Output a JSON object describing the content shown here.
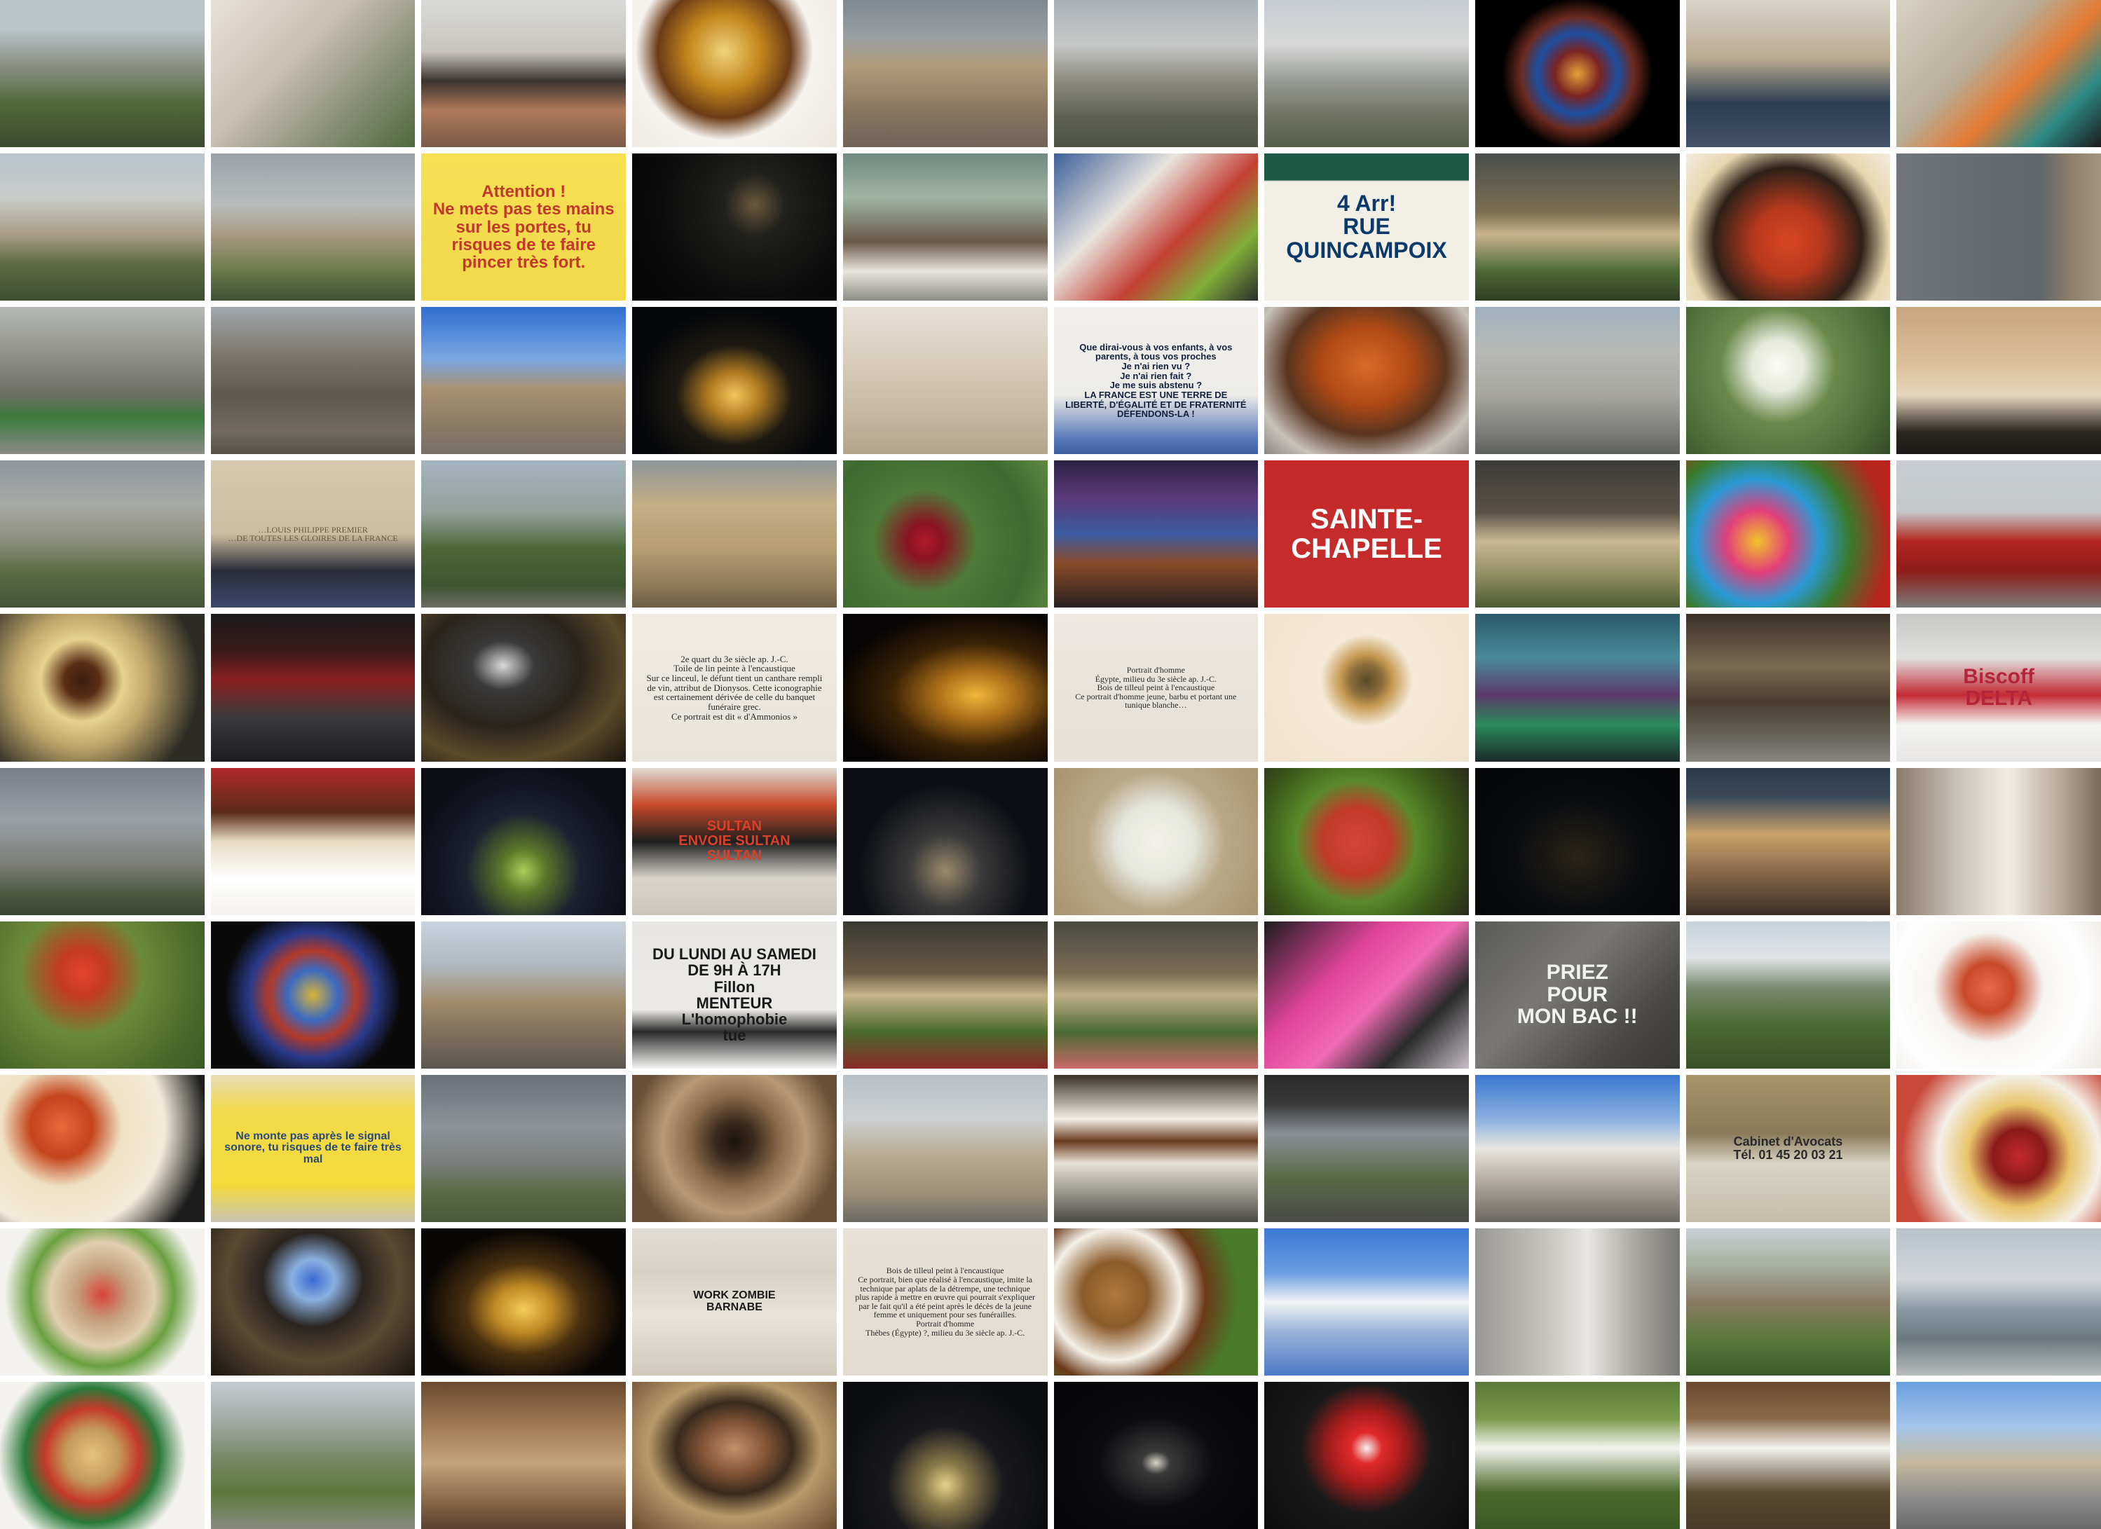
{
  "gallery": {
    "tiles": [
      {
        "bg": "linear-gradient(180deg,#b9c4c9 0%,#b9c4c9 20%,#8a8f82 45%,#4f6a3a 70%,#3a4a2e 100%)"
      },
      {
        "bg": "linear-gradient(135deg,#e8e1d6 0%,#c9bfb0 40%,#8a9078 70%,#4c6a3c 100%)"
      },
      {
        "bg": "linear-gradient(180deg,#d9dad8 0%,#c8c4bd 35%,#3a3430 55%,#b07a5a 75%,#7a5a48 100%)"
      },
      {
        "bg": "radial-gradient(circle at 45% 35%,#f1d27a 0%,#c2861c 25%,#6b3b16 45%,#f6f3ef 60%,#ebe5dd 100%)"
      },
      {
        "bg": "linear-gradient(180deg,#7f8890 0%,#9aa0a3 25%,#b29b7c 45%,#8a7660 75%,#6e6458 100%)"
      },
      {
        "bg": "linear-gradient(180deg,#a9b0b7 0%,#c7c9c8 30%,#8b8a7f 55%,#5e6152 80%,#4e5445 100%)"
      },
      {
        "bg": "linear-gradient(180deg,#c6ccd2 0%,#d8d9d8 30%,#979a94 55%,#6e715e 80%,#55604a 100%)"
      },
      {
        "bg": "radial-gradient(circle at 50% 50%,#e7a13a 0%,#7a2323 18%,#1d4ea0 32%,#6b2a1f 45%,#000000 60%)"
      },
      {
        "bg": "linear-gradient(180deg,#d9d4ca 0%,#b8aa90 40%,#2c3e52 70%,#42536a 100%)"
      },
      {
        "bg": "linear-gradient(135deg,#d8d2c3 0%,#b7ad98 40%,#e47a32 60%,#2d8b86 80%,#1b1b1b 100%)"
      },
      {
        "bg": "linear-gradient(180deg,#b8c3cc 0%,#c9ccc9 30%,#a99d86 55%,#5d6b44 75%,#3e4d30 100%)"
      },
      {
        "bg": "linear-gradient(180deg,#9aa2a8 0%,#b8bcbc 35%,#a89a82 55%,#6a7a4a 80%,#3f5032 100%)"
      },
      {
        "bg": "linear-gradient(180deg,#f7e053 0%,#f2d84a 100%)",
        "caption": "Attention !\nNe mets pas tes mains sur les portes, tu risques de te faire pincer très fort.",
        "fg": "#c0392b",
        "fs": "24px",
        "fw": "700"
      },
      {
        "bg": "radial-gradient(circle at 60% 35%,#6a5a3c 0%,#20201c 20%,#0c0c0c 60%,#050505 100%)"
      },
      {
        "bg": "linear-gradient(180deg,#6f8a80 0%,#9fb4a4 30%,#6a5a48 60%,#e9e5de 80%,#8c8c86 100%)"
      },
      {
        "bg": "linear-gradient(135deg,#3c5f9a 0%,#e8e4de 35%,#c44034 60%,#7fae3a 80%,#2c2c2c 100%)"
      },
      {
        "bg": "linear-gradient(180deg,#1c5a45 0%,#1c5a45 18%,#f2efe6 19%,#f2efe6 100%)",
        "caption": "4 Arr!\nRUE\nQUINCAMPOIX",
        "fg": "#0b3a6a",
        "fs": "32px",
        "fw": "700"
      },
      {
        "bg": "linear-gradient(180deg,#4a4f4c 0%,#7c6f52 40%,#c8b38a 55%,#4c6a35 80%,#2f3d22 100%)"
      },
      {
        "bg": "radial-gradient(circle at 50% 60%,#d9461f 0%,#b8391e 25%,#2d2118 55%,#e8d7b0 75%,#f2ece0 100%)"
      },
      {
        "bg": "linear-gradient(90deg,#6f757b 0%,#5f666c 70%,#8d7f6a 85%,#a39580 100%)"
      },
      {
        "bg": "linear-gradient(180deg,#b6b8b4 0%,#8c8e86 35%,#6b6e63 60%,#3c7a3c 75%,#8a8c88 100%)"
      },
      {
        "bg": "linear-gradient(180deg,#a2a8ad 0%,#7a7368 35%,#5f5950 60%,#726a5e 85%,#555048 100%)"
      },
      {
        "bg": "linear-gradient(180deg,#2e6fd0 0%,#7aa6e4 35%,#a89274 55%,#8c7b64 80%,#777069 100%)"
      },
      {
        "bg": "radial-gradient(ellipse at 50% 60%,#f3c55a 0%,#b07b22 18%,#1e1a12 40%,#04060a 70%)"
      },
      {
        "bg": "linear-gradient(180deg,#e6dfd4 0%,#d6cbb8 40%,#c7b9a2 70%,#b3a58c 100%)"
      },
      {
        "bg": "linear-gradient(180deg,#f2f0ec 0%,#ecebe7 60%,#5677b8 90%,#3d5f9f 100%)",
        "caption": "Que dirai-vous à vos enfants, à vos parents, à tous vos proches\nJe n'ai rien vu ?\nJe n'ai rien fait ?\nJe me suis abstenu ?\nLA FRANCE EST UNE TERRE DE LIBERTÉ, D'ÉGALITÉ ET DE FRATERNITÉ\nDÉFENDONS-LA !",
        "fg": "#12213d",
        "fs": "13px",
        "fw": "700"
      },
      {
        "bg": "radial-gradient(ellipse at 50% 40%,#d96a2a 0%,#b34a15 30%,#5a3520 55%,#c7c2ba 80%,#8a8580 100%)"
      },
      {
        "bg": "linear-gradient(180deg,#9fb1bf 0%,#b7b9b5 30%,#a7a6a0 60%,#7c7d79 85%,#5e605c 100%)"
      },
      {
        "bg": "radial-gradient(circle at 45% 40%,#fbfbf5 0%,#e6eadc 18%,#6a8a4c 40%,#4a6b36 75%,#33492a 100%)"
      },
      {
        "bg": "linear-gradient(180deg,#c9a57b 0%,#dcc19a 40%,#e6d6be 60%,#2a2620 85%,#1c1a16 100%)"
      },
      {
        "bg": "linear-gradient(180deg,#8e969c 0%,#a8aaa6 30%,#8b8e7b 55%,#5d6d44 75%,#45543a 100%)"
      },
      {
        "bg": "linear-gradient(180deg,#d6c9ae 0%,#cbbd9f 50%,#2a2c38 75%,#3c4a6e 100%)",
        "caption": "…LOUIS PHILIPPE PREMIER\n…DE TOUTES LES GLOIRES DE LA FRANCE",
        "fg": "#6a5a3a",
        "fs": "12px",
        "fw": "400"
      },
      {
        "bg": "linear-gradient(180deg,#a5b3c0 0%,#92a19a 35%,#4c6838 60%,#3c5530 85%,#6e6c64 100%)"
      },
      {
        "bg": "linear-gradient(180deg,#8d959a 0%,#c4ae84 30%,#b79e72 60%,#8f7a58 85%,#6d5e48 100%)"
      },
      {
        "bg": "radial-gradient(circle at 40% 55%,#b21b2c 0%,#8a1322 12%,#4f7a38 35%,#3f6a2e 70%,#5e8a42 100%)"
      },
      {
        "bg": "linear-gradient(180deg,#2a2140 0%,#5d3a7a 25%,#3c5aa0 50%,#8a4a2a 70%,#2a2020 100%)"
      },
      {
        "bg": "linear-gradient(180deg,#c42a2a 0%,#c62c2c 100%)",
        "caption": "SAINTE-\nCHAPELLE",
        "fg": "#ffffff",
        "fs": "40px",
        "fw": "700"
      },
      {
        "bg": "linear-gradient(180deg,#3c3c38 0%,#5a5146 35%,#c9b994 55%,#8a8a5a 80%,#4c5a34 100%)"
      },
      {
        "bg": "radial-gradient(circle at 35% 55%,#f0c22a 0%,#e2407a 20%,#2a9ad6 40%,#3a7a2a 60%,#b8251e 85%)"
      },
      {
        "bg": "linear-gradient(180deg,#c7cdd2 0%,#c4c8ca 35%,#b3261e 55%,#8f1d18 75%,#7a7a78 100%)"
      },
      {
        "bg": "radial-gradient(circle at 40% 45%,#3a1e10 0%,#5a2e16 12%,#e6d28e 28%,#bfa56a 45%,#2c2c24 80%)"
      },
      {
        "bg": "linear-gradient(180deg,#1a1a1c 0%,#3a1a1a 25%,#8a2020 45%,#3a3a3c 70%,#1c1c20 100%)"
      },
      {
        "bg": "radial-gradient(ellipse at 40% 35%,#d9d9d9 0%,#3a3a3a 18%,#2a241c 45%,#5a4a2a 70%,#1a140e 100%)"
      },
      {
        "bg": "linear-gradient(180deg,#efebe3 0%,#e9e4da 100%)",
        "caption": "2e quart du 3e siècle ap. J.-C.\nToile de lin peinte à l'encaustique\nSur ce linceul, le défunt tient un canthare rempli de vin, attribut de Dionysos. Cette iconographie est certainement dérivée de celle du banquet funéraire grec.\nCe portrait est dit « d'Ammonios »",
        "fg": "#2a2a2a",
        "fs": "13px",
        "fw": "400"
      },
      {
        "bg": "radial-gradient(ellipse at 65% 55%,#f2b43a 0%,#b0721a 20%,#3a2206 45%,#060404 75%)"
      },
      {
        "bg": "linear-gradient(180deg,#ece8e1 0%,#e6e0d6 100%)",
        "caption": "Portrait d'homme\nÉgypte, milieu du 3e siècle ap. J.-C.\nBois de tilleul peint à l'encaustique\nCe portrait d'homme jeune, barbu et portant une tunique blanche…",
        "fg": "#2a2a2a",
        "fs": "12px",
        "fw": "400"
      },
      {
        "bg": "radial-gradient(circle at 50% 45%,#5a4a2a 0%,#8a6c3a 12%,#c59a52 20%,#f4e9d6 35%,#efe3cc 100%)"
      },
      {
        "bg": "linear-gradient(180deg,#2a5a6a 0%,#4a8a9a 30%,#5a3a6a 55%,#2a8a5a 75%,#1a2a2a 100%)"
      },
      {
        "bg": "linear-gradient(180deg,#3a3028 0%,#7a6a52 35%,#4a3e30 60%,#6a6860 85%,#8a8882 100%)"
      },
      {
        "bg": "linear-gradient(180deg,#c8c8c6 0%,#e0e0de 30%,#c42a34 55%,#f4f4f2 75%,#e8e6e4 100%)",
        "caption": "Biscoff\nDELTA",
        "fg": "#b3263a",
        "fs": "30px",
        "fw": "700"
      },
      {
        "bg": "linear-gradient(180deg,#7a8088 0%,#9aa0a6 35%,#7c7e78 65%,#4e5a40 85%,#3a4530 100%)"
      },
      {
        "bg": "linear-gradient(180deg,#b42a2a 0%,#5a2a1a 30%,#e7dcc2 50%,#ffffff 75%,#f4f2ee 100%)"
      },
      {
        "bg": "radial-gradient(ellipse at 50% 70%,#a8ce5a 0%,#5a7a2a 15%,#1c2030 40%,#0c0e16 75%)"
      },
      {
        "bg": "linear-gradient(180deg,#e0dcd4 0%,#c84a2a 25%,#1e1e1e 50%,#d9d5cc 75%,#c9c5bc 100%)",
        "caption": "SULTAN\nENVOIE SULTAN\nSULTAN",
        "fg": "#d9402a",
        "fs": "20px",
        "fw": "700"
      },
      {
        "bg": "radial-gradient(ellipse at 50% 70%,#9a8a6a 0%,#3a3a3a 25%,#0c0e14 60%)"
      },
      {
        "bg": "radial-gradient(circle at 50% 50%,#f4f2ea 0%,#e4e6dc 30%,#b9a888 55%,#a89270 100%)"
      },
      {
        "bg": "radial-gradient(circle at 45% 50%,#d9443a 0%,#c23a2a 25%,#5a8a2a 45%,#3a5a1a 70%,#2a2a1a 100%)"
      },
      {
        "bg": "radial-gradient(ellipse at 50% 60%,#2a2418 0%,#0a0c10 45%,#050608 100%)"
      },
      {
        "bg": "linear-gradient(180deg,#2a3a4a 0%,#3c4a5a 20%,#c9a26a 45%,#8a6a4a 70%,#3a2e24 100%)"
      },
      {
        "bg": "linear-gradient(90deg,#8a7a6a 0%,#c9c2b6 30%,#f2ede4 55%,#b7aa98 80%,#7a6a5a 100%)"
      },
      {
        "bg": "radial-gradient(circle at 40% 35%,#e5452a 0%,#c43a22 15%,#6a8a3a 40%,#4a6a2a 75%,#3a5a24 100%)"
      },
      {
        "bg": "radial-gradient(circle at 50% 50%,#d9b23a 0%,#3a6ac0 20%,#b23a2a 35%,#2a3a8a 50%,#0a0a0a 70%)"
      },
      {
        "bg": "linear-gradient(180deg,#c8d3de 0%,#b0b8bf 30%,#a08a6a 55%,#7a6c5a 80%,#5a5650 100%)"
      },
      {
        "bg": "linear-gradient(180deg,#e8e6e2 0%,#ebe9e5 60%,#2a2a2a 75%,#f4f4f2 100%)",
        "caption": "DU LUNDI AU SAMEDI DE 9H À 17H\nFillon\nMENTEUR\nL'homophobie\ntue",
        "fg": "#1a1a1a",
        "fs": "22px",
        "fw": "700"
      },
      {
        "bg": "linear-gradient(180deg,#3a3a34 0%,#6a5a44 35%,#c8b48a 50%,#4a6a2a 75%,#8a2a2a 100%)"
      },
      {
        "bg": "linear-gradient(180deg,#4a4a42 0%,#7a6c54 35%,#bfae88 50%,#4a6a34 75%,#c86a6a 100%)"
      },
      {
        "bg": "linear-gradient(135deg,#1c1c1c 0%,#e0449a 35%,#f06ab4 55%,#2a2a2a 75%,#c8c0c8 100%)"
      },
      {
        "bg": "linear-gradient(135deg,#5a5a56 0%,#7a7874 40%,#4a4844 75%,#3a3834 100%)",
        "caption": "PRIEZ\nPOUR\nMON BAC !!",
        "fg": "#f2f2f0",
        "fs": "30px",
        "fw": "700"
      },
      {
        "bg": "linear-gradient(180deg,#c8d2dc 0%,#e0e3e6 25%,#7a8a70 45%,#4a6a34 70%,#3a5028 100%)"
      },
      {
        "bg": "radial-gradient(circle at 45% 45%,#e86a4a 0%,#c84a2a 18%,#f6f4f0 40%,#ffffff 70%,#ece8e2 100%)"
      },
      {
        "bg": "radial-gradient(circle at 30% 35%,#e8693a 0%,#c4441c 18%,#efe2c4 35%,#f2ead8 60%,#1c1c1c 85%)"
      },
      {
        "bg": "linear-gradient(180deg,#e8dcb4 0%,#f2d94a 25%,#f4da3a 75%,#c9c4b4 100%)",
        "caption": "Ne monte pas après le signal sonore, tu risques de te faire très mal",
        "fg": "#2a4a7a",
        "fs": "16px",
        "fw": "700"
      },
      {
        "bg": "linear-gradient(180deg,#6a7078 0%,#8c9298 35%,#7a7e7c 60%,#5a6a44 80%,#4a5a3a 100%)"
      },
      {
        "bg": "radial-gradient(circle at 50% 45%,#1a140e 0%,#3a2a1c 15%,#8a6a4a 35%,#b89a74 55%,#6a5038 80%)"
      },
      {
        "bg": "linear-gradient(180deg,#b8c0c6 0%,#ccd0d2 30%,#b8aa90 55%,#9e9078 80%,#6a6a64 100%)"
      },
      {
        "bg": "linear-gradient(180deg,#3a3228 0%,#f4f0e8 30%,#6a3a20 45%,#e8e2d6 60%,#4a4a44 100%)"
      },
      {
        "bg": "linear-gradient(180deg,#2a2a2a 0%,#3a3a3a 20%,#8a9098 40%,#5a6a44 70%,#4a4a48 100%)"
      },
      {
        "bg": "linear-gradient(180deg,#3a78d0 0%,#8ab0e0 30%,#e8e6e0 50%,#b8b0a4 70%,#6a6660 100%)"
      },
      {
        "bg": "linear-gradient(180deg,#a89468 0%,#8a7a5a 40%,#d9d4c4 60%,#c4bca8 100%)",
        "caption": "Cabinet d'Avocats\nTél. 01 45 20 03 21",
        "fg": "#2a2a2a",
        "fs": "18px",
        "fw": "700"
      },
      {
        "bg": "radial-gradient(circle at 60% 55%,#c42a2a 0%,#8a1a1a 18%,#e8c46a 35%,#f4f0e8 55%,#c84a3a 80%)"
      },
      {
        "bg": "radial-gradient(circle at 50% 45%,#d9443a 0%,#c4a07a 20%,#e0ceb0 40%,#6aa040 55%,#f4f2ee 75%)"
      },
      {
        "bg": "radial-gradient(ellipse at 50% 35%,#3a6ad0 0%,#8ab0e0 15%,#2a2420 35%,#5a4a32 60%,#1a1510 100%)"
      },
      {
        "bg": "radial-gradient(ellipse at 50% 55%,#f4cc5a 0%,#c08a24 20%,#4a3010 40%,#080604 70%)"
      },
      {
        "bg": "linear-gradient(180deg,#e0dcd4 0%,#d8d2c6 30%,#e8e4dc 60%,#cfc8ba 100%)",
        "caption": "WORK ZOMBIE\nBARNABE",
        "fg": "#1a1a1a",
        "fs": "16px",
        "fw": "700"
      },
      {
        "bg": "linear-gradient(180deg,#e6e0d6 0%,#e2dcd0 100%)",
        "caption": "Bois de tilleul peint à l'encaustique\nCe portrait, bien que réalisé à l'encaustique, imite la technique par aplats de la détrempe, une technique plus rapide à mettre en œuvre qui pourrait s'expliquer par le fait qu'il a été peint après le décès de la jeune femme et uniquement pour ses funérailles.\nPortrait d'homme\nThèbes (Égypte) ?, milieu du 3e siècle ap. J.-C.",
        "fg": "#2a2a2a",
        "fs": "12px",
        "fw": "400"
      },
      {
        "bg": "radial-gradient(circle at 30% 45%,#b07a3a 0%,#8a5a2a 20%,#f4f0e8 40%,#6a3a1a 55%,#4a7a2a 75%)"
      },
      {
        "bg": "linear-gradient(180deg,#3c7ad6 0%,#6a9ce0 30%,#f2f4f6 50%,#9ab4d8 70%,#4a7ac8 100%)"
      },
      {
        "bg": "linear-gradient(90deg,#9a9894 0%,#c6c4be 35%,#e8e6e2 55%,#a4a29c 80%,#7a7874 100%)"
      },
      {
        "bg": "linear-gradient(180deg,#c8d0d6 0%,#a8b0a0 25%,#8a7a64 50%,#5a7a3a 75%,#3a5a2a 100%)"
      },
      {
        "bg": "linear-gradient(180deg,#b8c2cc 0%,#d2d6da 35%,#8a9aa4 55%,#6a7a80 75%,#b8bcbc 100%)"
      },
      {
        "bg": "radial-gradient(circle at 45% 50%,#e8c27a 0%,#c49a5a 20%,#c43a2a 35%,#2a7a3a 50%,#f4f2ee 70%)"
      },
      {
        "bg": "linear-gradient(180deg,#c4ccd2 0%,#a4aca8 25%,#7a8a6a 50%,#5a7a3a 75%,#8a8a80 100%)"
      },
      {
        "bg": "linear-gradient(180deg,#6a4a30 0%,#a07a52 30%,#c4a47a 55%,#8a6a48 80%,#5a4030 100%)"
      },
      {
        "bg": "radial-gradient(ellipse at 50% 45%,#c4906a 0%,#8a5a3a 20%,#3a2a1c 40%,#b89a6a 60%,#6a4a30 100%)"
      },
      {
        "bg": "radial-gradient(ellipse at 50% 70%,#e8d28a 0%,#8a7a4a 15%,#1a1a1e 40%,#0a0c10 75%)"
      },
      {
        "bg": "radial-gradient(ellipse at 50% 55%,#d8d4c8 0%,#3a3a3a 10%,#0c0c10 40%,#060608 100%)"
      },
      {
        "bg": "radial-gradient(circle at 50% 45%,#f4f2ee 0%,#e02a2a 12%,#a81c1c 28%,#1a1a1a 50%,#0c0c0c 100%)"
      },
      {
        "bg": "linear-gradient(180deg,#5a7a3a 0%,#7a9a4a 25%,#f4f4f0 45%,#4a6a2a 75%,#3a5a24 100%)"
      },
      {
        "bg": "linear-gradient(180deg,#6a4a30 0%,#8a6a4a 25%,#f4f4f0 45%,#5a4a30 75%,#4a3a28 100%)"
      },
      {
        "bg": "linear-gradient(180deg,#6aa0e0 0%,#a4c4ea 30%,#c4b89c 55%,#8a8a8a 80%,#6a6a6a 100%)"
      }
    ]
  }
}
